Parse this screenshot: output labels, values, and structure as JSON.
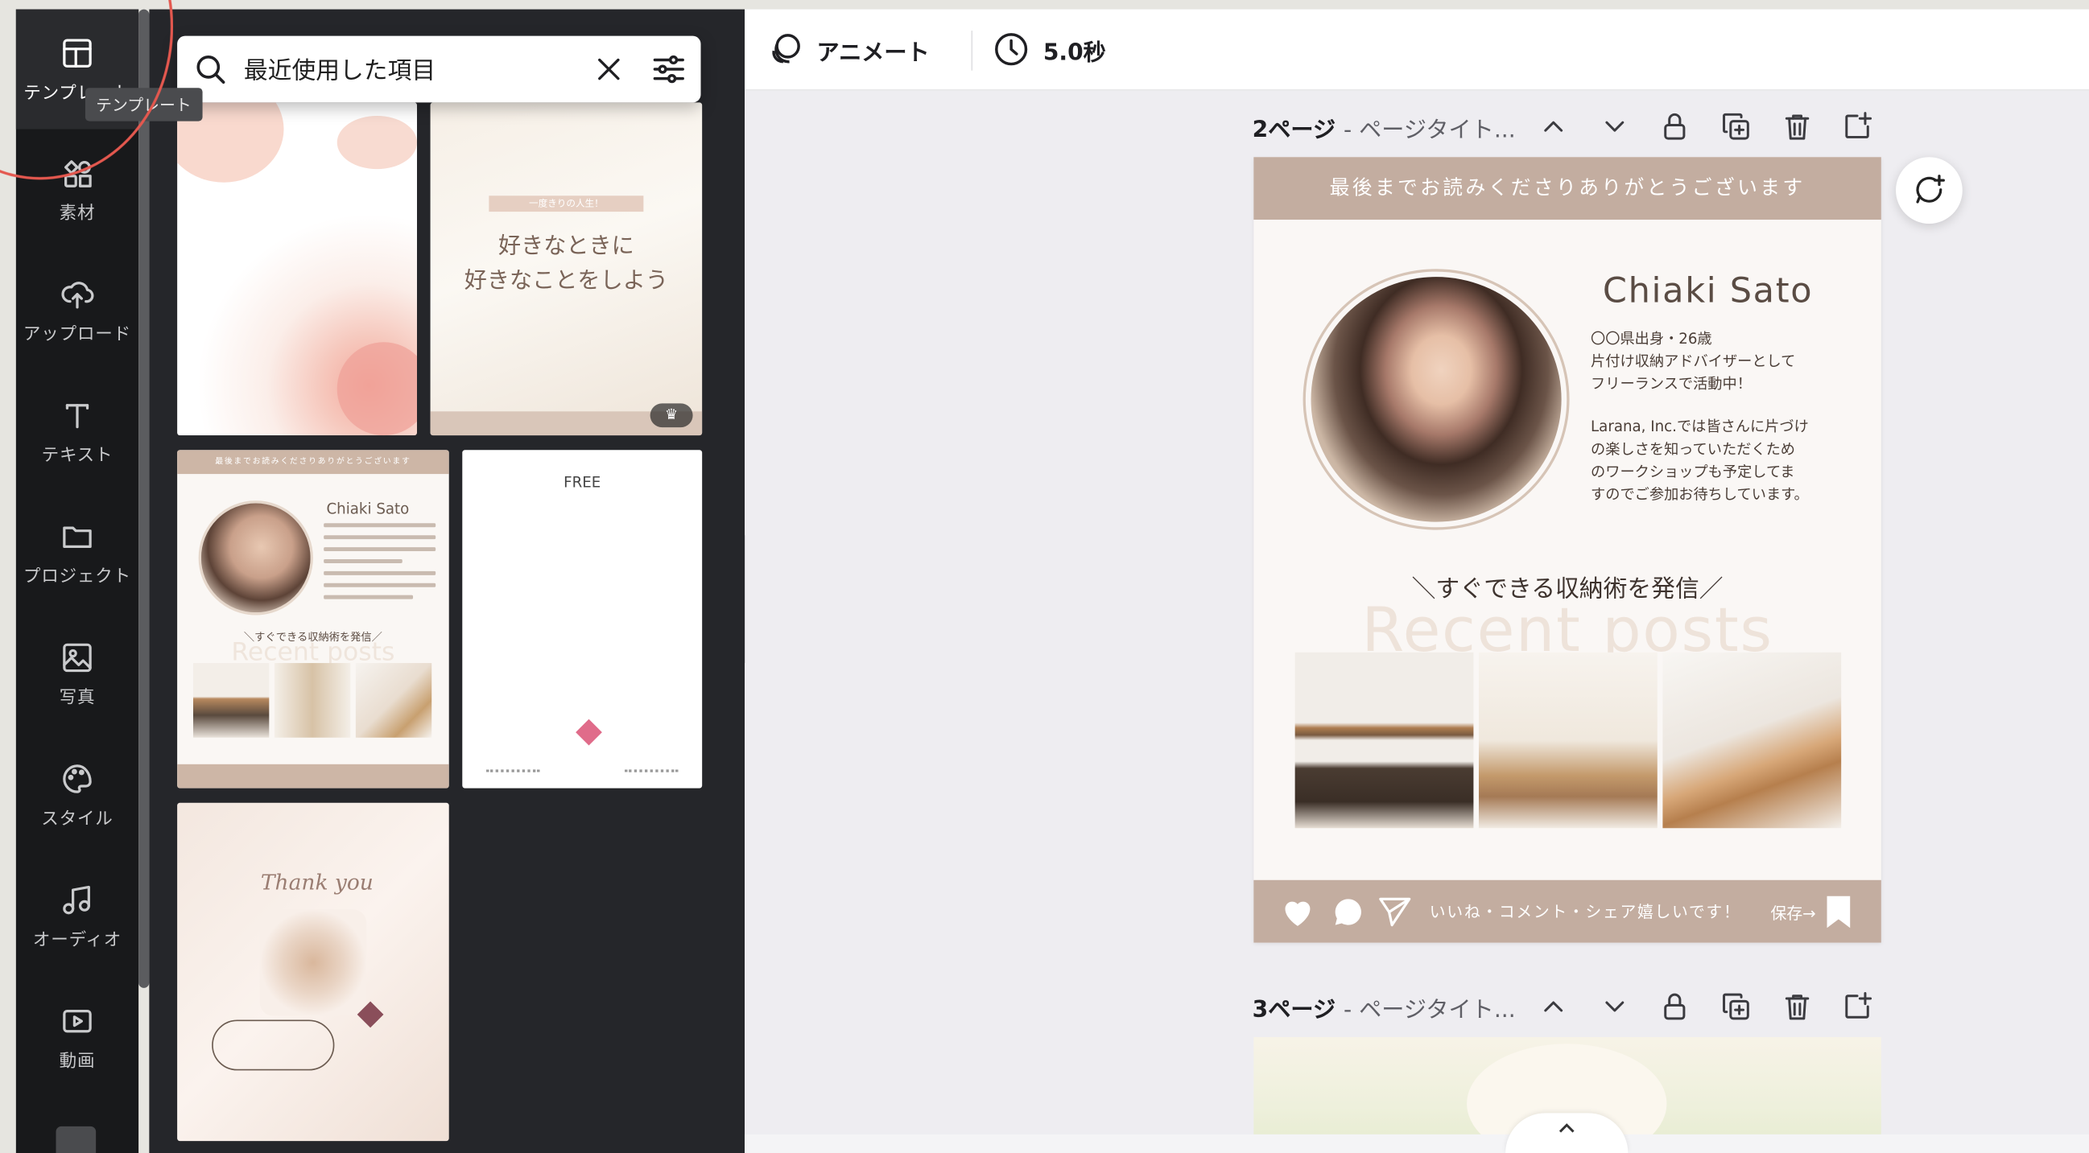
{
  "sidebar": {
    "items": [
      {
        "label": "テンプレート",
        "icon": "template-icon"
      },
      {
        "label": "素材",
        "icon": "elements-icon"
      },
      {
        "label": "アップロード",
        "icon": "upload-icon"
      },
      {
        "label": "テキスト",
        "icon": "text-icon"
      },
      {
        "label": "プロジェクト",
        "icon": "folder-icon"
      },
      {
        "label": "写真",
        "icon": "photo-icon"
      },
      {
        "label": "スタイル",
        "icon": "palette-icon"
      },
      {
        "label": "オーディオ",
        "icon": "music-icon"
      },
      {
        "label": "動画",
        "icon": "video-icon"
      }
    ],
    "tooltip": "テンプレート"
  },
  "panel": {
    "search_value": "最近使用した項目",
    "thumb2_band": "一度きりの人生！",
    "thumb2_heading": "好きなときに\n好きなことをしよう",
    "thumb3_bar": "最後までお読みくださりありがとうございます",
    "thumb3_name": "Chiaki Sato",
    "thumb3_sub": "＼すぐできる収納術を発信／",
    "thumb3_rp": "Recent posts",
    "thumb4_free": "FREE",
    "thumb5_cursive": "Thank you"
  },
  "topbar": {
    "animate_label": "アニメート",
    "duration_label": "5.0秒"
  },
  "pages": [
    {
      "number": "2ページ",
      "title": "- ページタイト..."
    },
    {
      "number": "3ページ",
      "title": "- ページタイト..."
    }
  ],
  "design": {
    "top_band": "最後までお読みくださりありがとうございます",
    "name": "Chiaki Sato",
    "bio1": "〇〇県出身・26歳\n片付け収納アドバイザーとして\nフリーランスで活動中！",
    "bio2": "Larana, Inc.では皆さんに片づけ\nの楽しさを知っていただくため\nのワークショップも予定してま\nすのでご参加お待ちしています。",
    "catch": "＼すぐできる収納術を発信／",
    "recent": "Recent posts",
    "footer_text": "いいね・コメント・シェア嬉しいです！",
    "save_label": "保存→"
  },
  "colors": {
    "accent_band": "#c3ada0",
    "rail_bg": "#18191b",
    "panel_bg": "#25262a",
    "highlight_ring": "#e4584f"
  }
}
